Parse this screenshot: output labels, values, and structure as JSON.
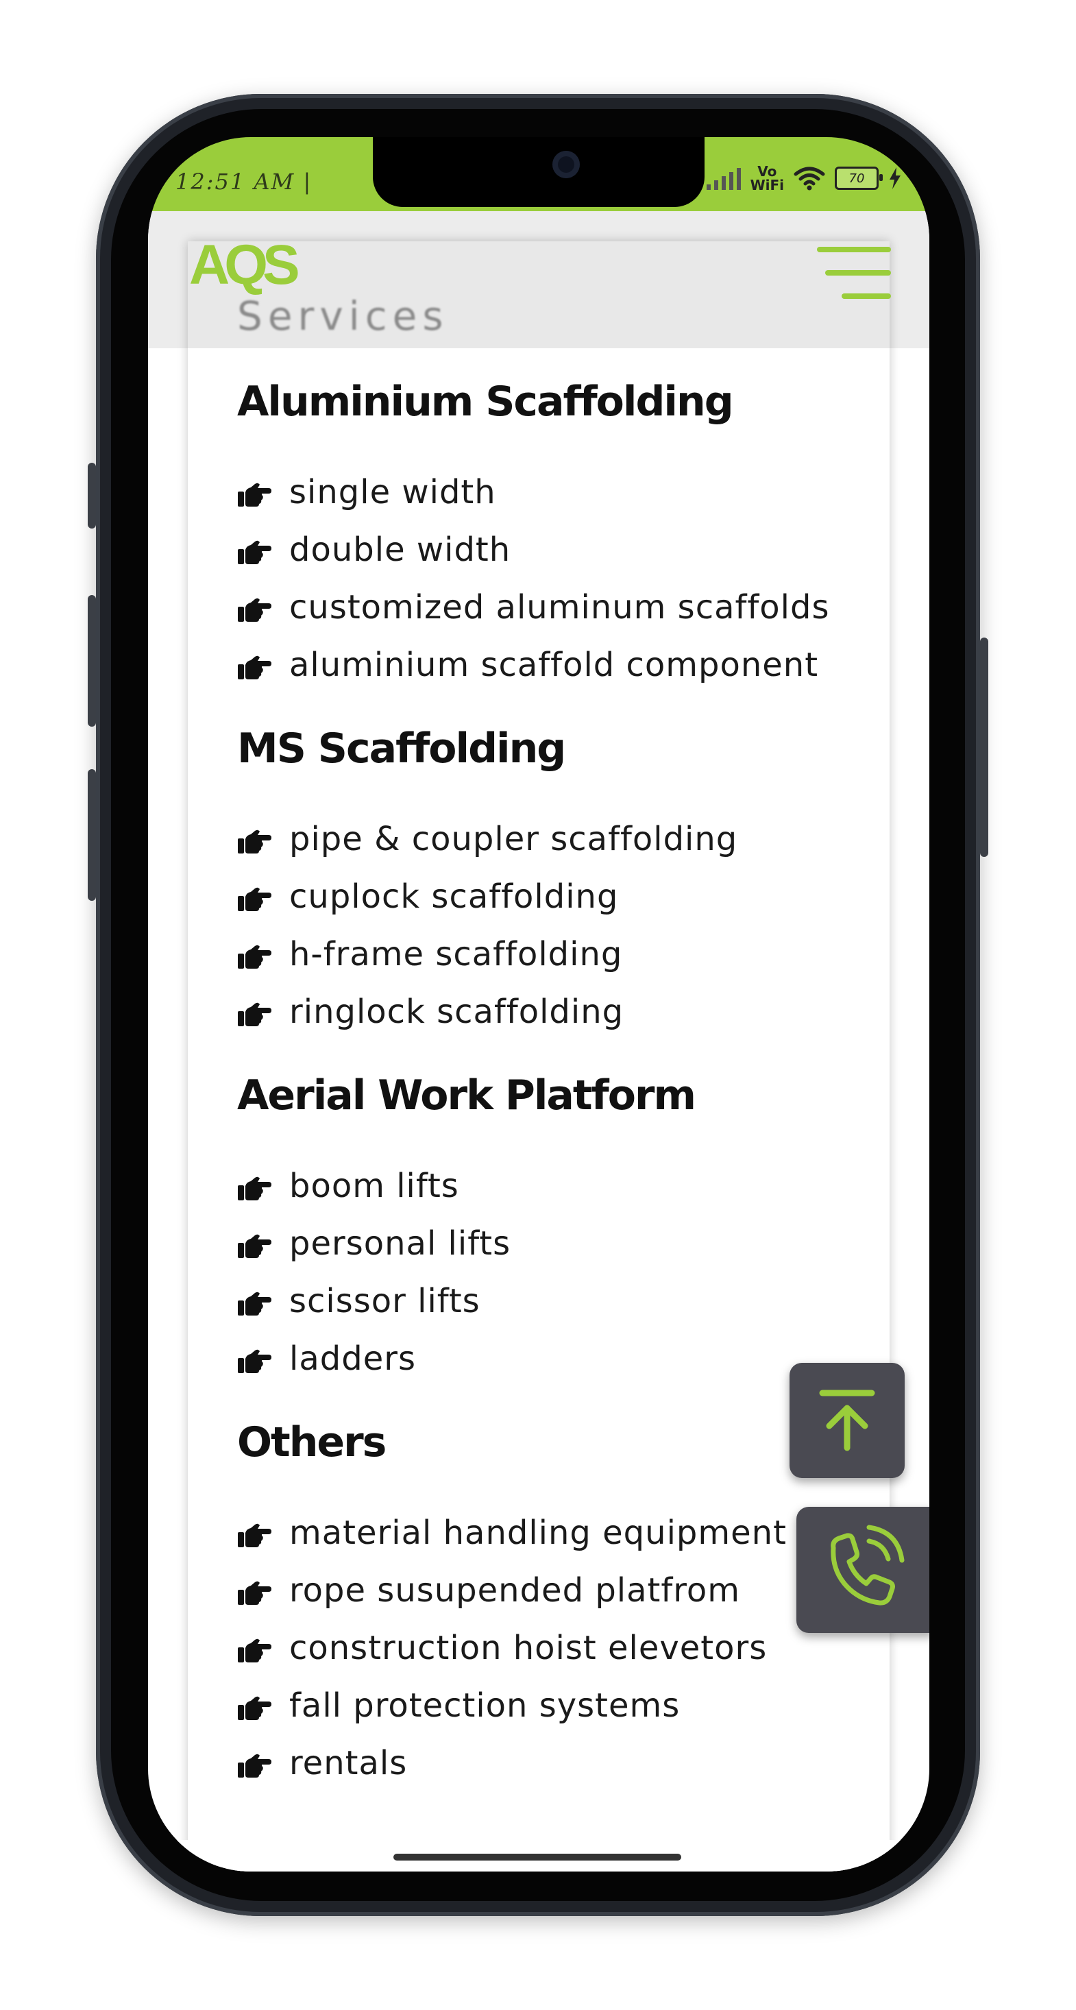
{
  "status_bar": {
    "time": "12:51 AM |",
    "vo_wifi_top": "Vo",
    "vo_wifi_bottom": "WiFi",
    "battery": "70",
    "bar_color": "#9acd3b"
  },
  "header": {
    "logo": "AQS",
    "page_title": "Services",
    "menu_icon": "hamburger-menu-icon",
    "accent_color": "#9acd3b"
  },
  "sections": [
    {
      "title": "Aluminium Scaffolding",
      "items": [
        "single width",
        "double width",
        "customized aluminum scaffolds",
        "aluminium scaffold component"
      ]
    },
    {
      "title": "MS Scaffolding",
      "items": [
        "pipe & coupler scaffolding",
        "cuplock scaffolding",
        "h-frame scaffolding",
        "ringlock scaffolding"
      ]
    },
    {
      "title": "Aerial Work Platform",
      "items": [
        "boom lifts",
        "personal lifts",
        "scissor lifts",
        "ladders"
      ]
    },
    {
      "title": "Others",
      "items": [
        "material handling equipment",
        "rope susupended platfrom",
        "construction hoist elevetors",
        "fall protection systems",
        "rentals"
      ]
    }
  ],
  "bullet_icon": "pointing-hand-icon",
  "floating_buttons": {
    "scroll_top_icon": "arrow-up-to-top-icon",
    "call_icon": "phone-call-icon",
    "button_color": "#4a4a52"
  }
}
